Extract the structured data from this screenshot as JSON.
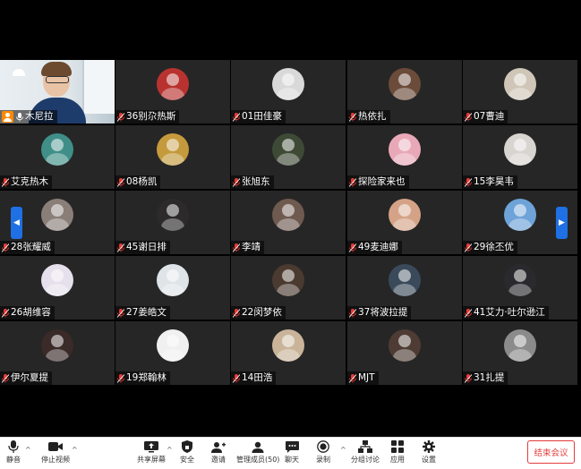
{
  "participants": [
    {
      "name": "木尼拉",
      "video": true
    },
    {
      "name": "36别尕热斯",
      "color": "#b8332f"
    },
    {
      "name": "01田佳豪",
      "color": "#d9d9d9"
    },
    {
      "name": "热依扎",
      "color": "#6b4b3a"
    },
    {
      "name": "07曹迪",
      "color": "#cfc6b8"
    },
    {
      "name": "艾克热木",
      "color": "#3f8f88"
    },
    {
      "name": "08杨凯",
      "color": "#c49a3c"
    },
    {
      "name": "张旭东",
      "color": "#3e4a36"
    },
    {
      "name": "探险家来也",
      "color": "#e9a8b8"
    },
    {
      "name": "15李昊韦",
      "color": "#d8d4d0"
    },
    {
      "name": "28张耀威",
      "color": "#8a7f78"
    },
    {
      "name": "45谢日排",
      "color": "#2c2a2a"
    },
    {
      "name": "李靖",
      "color": "#6f5a50"
    },
    {
      "name": "49麦迪娜",
      "color": "#d4a387"
    },
    {
      "name": "29徐丕优",
      "color": "#6da3d8"
    },
    {
      "name": "26胡维容",
      "color": "#e6e0ec"
    },
    {
      "name": "27姜皓文",
      "color": "#dfe4e9"
    },
    {
      "name": "22闵梦依",
      "color": "#4a3a30"
    },
    {
      "name": "37将波拉提",
      "color": "#3a4a5a"
    },
    {
      "name": "41艾力·吐尔逊江",
      "color": "#2a2a2e"
    },
    {
      "name": "伊尔夏提",
      "color": "#3a2a28"
    },
    {
      "name": "19郑翰林",
      "color": "#f0f0f0"
    },
    {
      "name": "14田浩",
      "color": "#c9b49a"
    },
    {
      "name": "MJT",
      "color": "#4e3c34"
    },
    {
      "name": "31扎提",
      "color": "#8b8b8b"
    }
  ],
  "toolbar": {
    "mute": "静音",
    "stop_video": "停止视频",
    "share_screen": "共享屏幕",
    "security": "安全",
    "invite": "邀请",
    "manage_participants": "管理成员(50)",
    "chat": "聊天",
    "record": "录制",
    "breakout_rooms": "分组讨论",
    "apps": "应用",
    "settings": "设置",
    "end_meeting": "结束会议"
  },
  "colors": {
    "accent": "#1f6fe5",
    "end": "#e43c3c",
    "host_badge": "#ff8a00"
  }
}
